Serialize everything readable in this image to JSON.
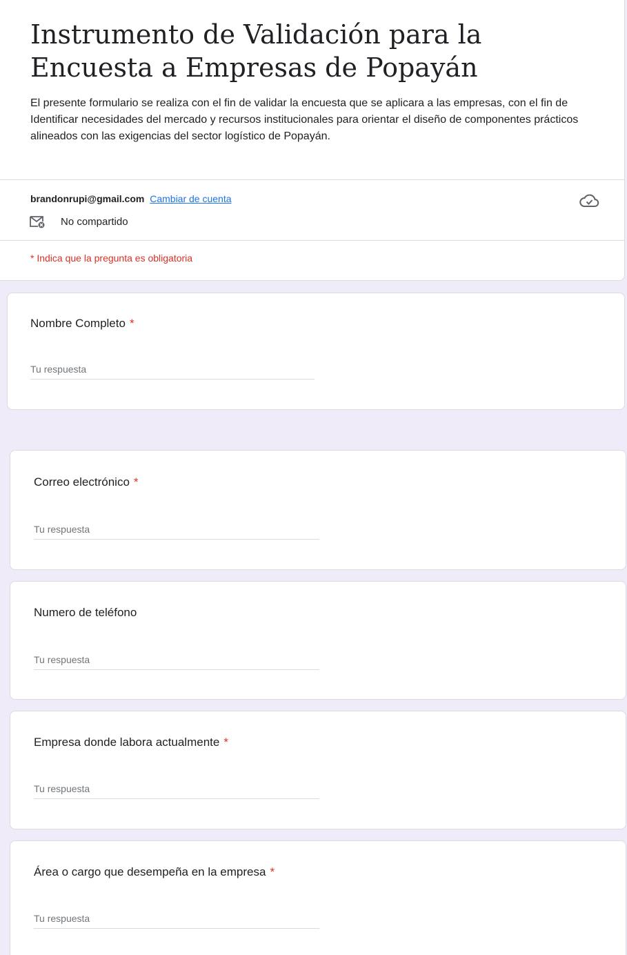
{
  "form": {
    "title": "Instrumento de Validación para la Encuesta a Empresas de Popayán",
    "description": "El presente formulario se realiza con el fin de validar la encuesta que se aplicara a las empresas, con el fin de Identificar necesidades del mercado y recursos institucionales para orientar el diseño de componentes prácticos alineados con las exigencias del sector logístico de Popayán."
  },
  "account": {
    "email": "brandonrupi@gmail.com",
    "switch_label": "Cambiar de cuenta",
    "share_status": "No compartido",
    "cloud_icon": "cloud-check-icon",
    "mail_icon": "mail-off-icon"
  },
  "required_note": "* Indica que la pregunta es obligatoria",
  "questions": [
    {
      "label": "Nombre Completo",
      "required_mark": "*",
      "placeholder": "Tu respuesta"
    },
    {
      "label": "Correo electrónico",
      "required_mark": "*",
      "placeholder": "Tu respuesta"
    },
    {
      "label": "Numero de teléfono",
      "required_mark": "",
      "placeholder": "Tu respuesta"
    },
    {
      "label": "Empresa donde labora actualmente",
      "required_mark": "*",
      "placeholder": "Tu respuesta"
    },
    {
      "label": "Área o cargo que desempeña en la empresa",
      "required_mark": "*",
      "placeholder": "Tu respuesta"
    }
  ],
  "colors": {
    "background": "#f0ebf8",
    "required": "#d93025",
    "link": "#1a73e8"
  }
}
